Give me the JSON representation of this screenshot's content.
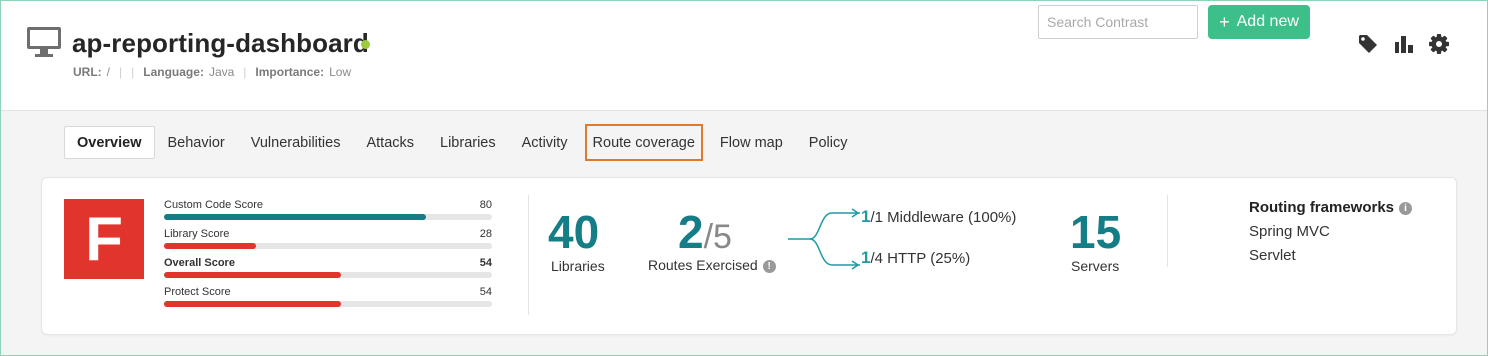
{
  "header": {
    "app_name": "ap-reporting-dashboard",
    "status_color": "#9ccc3c",
    "meta": {
      "url_label": "URL:",
      "url_value": "/",
      "language_label": "Language:",
      "language_value": "Java",
      "importance_label": "Importance:",
      "importance_value": "Low"
    },
    "search_placeholder": "Search Contrast",
    "add_new_label": "Add new",
    "icons": [
      "tag-icon",
      "bar-chart-icon",
      "gear-icon"
    ]
  },
  "tabs": [
    {
      "label": "Overview",
      "active": true
    },
    {
      "label": "Behavior"
    },
    {
      "label": "Vulnerabilities"
    },
    {
      "label": "Attacks"
    },
    {
      "label": "Libraries"
    },
    {
      "label": "Activity"
    },
    {
      "label": "Route coverage",
      "highlighted": true
    },
    {
      "label": "Flow map"
    },
    {
      "label": "Policy"
    }
  ],
  "summary": {
    "grade": "F",
    "grade_color": "#e0342c",
    "scores": [
      {
        "label": "Custom Code Score",
        "value": "80",
        "percent": 80,
        "color": "#147d86"
      },
      {
        "label": "Library Score",
        "value": "28",
        "percent": 28,
        "color": "#e0342c"
      },
      {
        "label": "Overall Score",
        "value": "54",
        "percent": 54,
        "color": "#e0342c",
        "bold": true
      },
      {
        "label": "Protect Score",
        "value": "54",
        "percent": 54,
        "color": "#e0342c"
      }
    ],
    "libraries_count": "40",
    "libraries_label": "Libraries",
    "routes_exercised": "2",
    "routes_total": "/5",
    "routes_label": "Routes Exercised",
    "middleware_num": "1",
    "middleware_text": "/1 Middleware (100%)",
    "http_num": "1",
    "http_text": "/4 HTTP (25%)",
    "servers_count": "15",
    "servers_label": "Servers",
    "routing_title": "Routing frameworks",
    "frameworks": [
      "Spring MVC",
      "Servlet"
    ]
  }
}
